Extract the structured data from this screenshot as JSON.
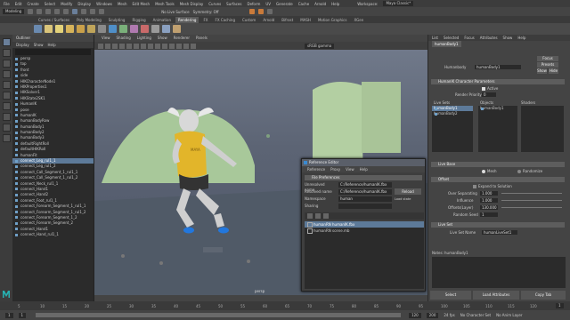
{
  "menubar": {
    "items": [
      "File",
      "Edit",
      "Create",
      "Select",
      "Modify",
      "Display",
      "Windows",
      "Mesh",
      "Edit Mesh",
      "Mesh Tools",
      "Mesh Display",
      "Curves",
      "Surfaces",
      "Deform",
      "UV",
      "Generate",
      "Cache",
      "Arnold",
      "Help"
    ],
    "workspace_label": "Workspace:",
    "workspace_value": "Maya Classic*"
  },
  "statusline": {
    "mode": "Modeling",
    "no_live_surface": "No Live Surface",
    "symmetry": "Symmetry: Off"
  },
  "shelf": {
    "tabs": [
      "Curves / Surfaces",
      "Poly Modeling",
      "Sculpting",
      "Rigging",
      "Animation",
      "Rendering",
      "FX",
      "FX Caching",
      "Custom",
      "Arnold",
      "Bifrost",
      "MASH",
      "Motion Graphics",
      "XGen"
    ],
    "active": "Rendering"
  },
  "outliner": {
    "title": "Outliner",
    "menu": [
      "Display",
      "Show",
      "Help"
    ],
    "rows": [
      "persp",
      "top",
      "front",
      "side",
      "HIKCharacterNode1",
      "HIKProperties1",
      "HIKSolver1",
      "HIKState2SK1",
      "HumanIK",
      "pose",
      "humanIK",
      "humanBodyRow",
      "humanBody1",
      "humanBody2",
      "humanBody3",
      "defaultRightRoll",
      "defaultHIKRoll",
      "humanFit",
      "connect_Leg_rul1_1",
      "connect_Leg_rul1_2",
      "connect_Call_Segment_1_rul1_1",
      "connect_Call_Segment_1_rul1_2",
      "connect_Neck_rul1_1",
      "connect_Hand1",
      "connect_Hand2",
      "connect_Foot_rul1_1",
      "connect_Forearm_Segment_1_rul1_1",
      "connect_Forearm_Segment_1_rul1_2",
      "connect_Forearm_Segment_1_2",
      "connect_Forearm_Segment_2",
      "connect_Hand1",
      "connect_Hand_rul1_1"
    ],
    "selected_index": 18
  },
  "viewport": {
    "menu": [
      "View",
      "Shading",
      "Lighting",
      "Show",
      "Renderer",
      "Panels"
    ],
    "colorspace": "sRGB gamma",
    "camera": "persp",
    "character_shirt_text": "MAYA"
  },
  "hypershade": {
    "title": "Reference Editor",
    "menu": [
      "Reference",
      "Proxy",
      "View",
      "Help"
    ],
    "section": "File Preferences",
    "fields": [
      {
        "label": "Unresolved name",
        "value": "C:/Reference/humanIK.fbx"
      },
      {
        "label": "Resolved name",
        "value": "C:/Reference/humanIK.fbx"
      },
      {
        "label": "Namespace",
        "value": "human"
      },
      {
        "label": "Sharing",
        "value": ""
      }
    ],
    "reload": "Reload",
    "load_label": "Load state",
    "list": [
      "humanRN  humanIK.fbx",
      "humanRN  scene.mb"
    ],
    "selected_index": 0
  },
  "attr": {
    "tabs": [
      "List",
      "Selected",
      "Focus",
      "Attributes",
      "Show",
      "Help"
    ],
    "node_tab": "humanBody1",
    "node_label": "Humanbody",
    "node_value": "humanBody1",
    "focus": "Focus",
    "presets": "Presets",
    "show": "Show",
    "hide": "Hide",
    "section1": "HumanIK Character Parameters",
    "active_label": "Active",
    "render_priority": "Render Priority",
    "render_priority_value": "0",
    "list1_header": "Live Sets",
    "list2_header": "Objects",
    "list3_header": "Shaders",
    "list1_items": [
      "humanBody1",
      "humanBody2"
    ],
    "list2_items": [
      "humanBody1"
    ],
    "section2": "Live Base",
    "radio1": "Mesh",
    "radio2": "Randomize",
    "section3": "Offset",
    "opt1": "Expand to Solution",
    "overlapping": "Over Separating",
    "overlapping_value": "1.000",
    "influence": "Influence",
    "influence_value": "1.000",
    "offset": "Offsets(Layer)",
    "offset_value": "130.000",
    "random_seed": "Random Seed",
    "random_seed_value": "1",
    "section4": "Live Set",
    "live_set_name": "Live Set Name",
    "live_set_value": "humanLiveSet1",
    "notes_label": "Notes:",
    "notes_value": "humanBody1",
    "select_btn": "Select",
    "load_attr_btn": "Load Attributes",
    "copy_tab_btn": "Copy Tab"
  },
  "timeline": {
    "ticks": [
      "5",
      "10",
      "15",
      "20",
      "25",
      "30",
      "35",
      "40",
      "45",
      "50",
      "55",
      "60",
      "65",
      "70",
      "75",
      "80",
      "85",
      "90",
      "95",
      "100",
      "105",
      "110",
      "115",
      "120"
    ],
    "current_frame": "1"
  },
  "rangebar": {
    "start": "1",
    "range_start": "1",
    "range_end": "120",
    "end": "200",
    "fps": "24 fps",
    "char_set": "No Character Set",
    "anim_layer": "No Anim Layer"
  }
}
